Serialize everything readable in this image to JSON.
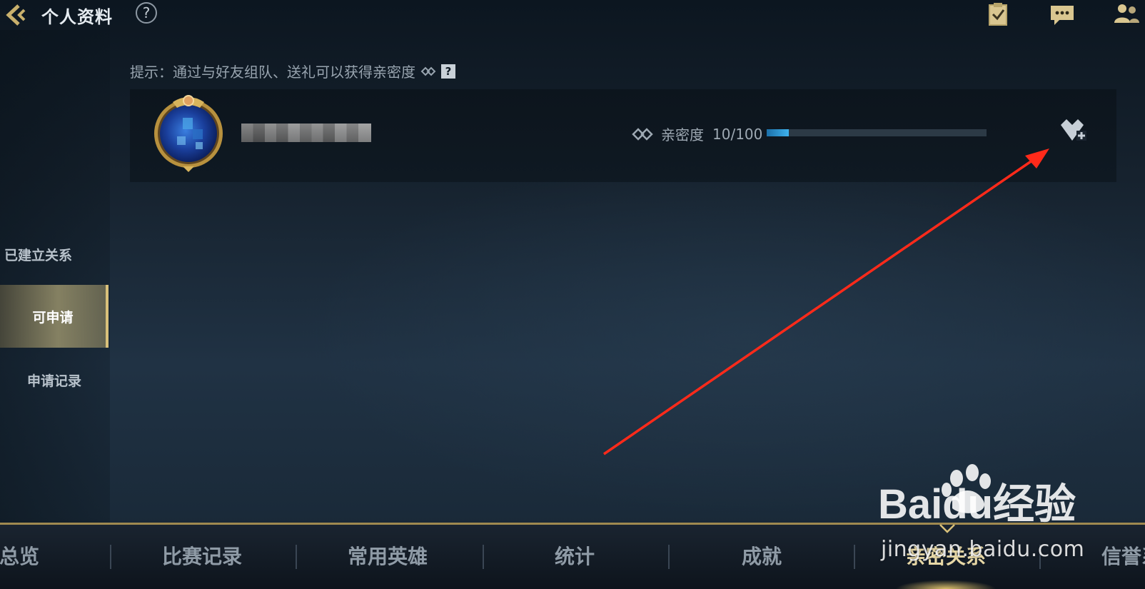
{
  "header": {
    "title": "个人资料",
    "help_label": "?"
  },
  "hint": {
    "text": "提示：通过与好友组队、送礼可以获得亲密度",
    "help_label": "?"
  },
  "sidebar": {
    "items": [
      {
        "label": "已建立关系",
        "active": false
      },
      {
        "label": "可申请",
        "active": true
      },
      {
        "label": "申请记录",
        "active": false
      }
    ]
  },
  "friend_card": {
    "intimacy_label": "亲密度",
    "intimacy_value": "10/100",
    "intimacy_progress": 0.1
  },
  "tabs": [
    {
      "label": "总览"
    },
    {
      "label": "比赛记录"
    },
    {
      "label": "常用英雄"
    },
    {
      "label": "统计"
    },
    {
      "label": "成就"
    },
    {
      "label": "亲密关系",
      "active": true
    },
    {
      "label": "信誉系"
    }
  ],
  "watermark": {
    "logo_text": "Baidu经验",
    "url": "jingyan.baidu.com"
  },
  "colors": {
    "accent_gold": "#d8c07a",
    "progress_blue": "#3eb2ee",
    "annotation_red": "#ff2a1a"
  },
  "icons": {
    "back": "chevron-left-icon",
    "help": "question-circle-icon",
    "tasks": "clipboard-check-icon",
    "chat": "chat-bubble-icon",
    "friends": "friends-icon",
    "intimacy": "linked-rings-icon",
    "add_intimate": "heart-plus-icon"
  }
}
